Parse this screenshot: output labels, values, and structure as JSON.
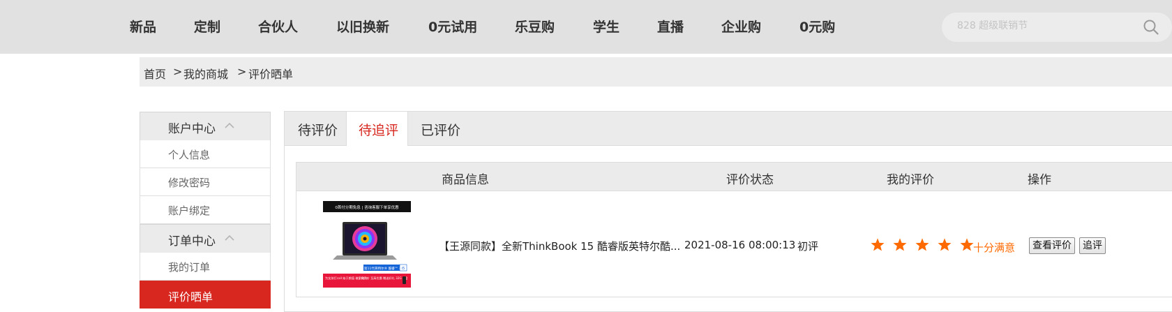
{
  "nav": {
    "items": [
      "新品",
      "定制",
      "合伙人",
      "以旧换新",
      "0元试用",
      "乐豆购",
      "学生",
      "直播",
      "企业购",
      "0元购"
    ],
    "search_placeholder": "828 超级联销节"
  },
  "breadcrumb": {
    "home": "首页",
    "sep1": ">",
    "mall": "我的商城",
    "sep2": ">",
    "current": "评价晒单"
  },
  "sidebar": {
    "account_section": {
      "label": "账户中心"
    },
    "account_items": [
      "个人信息",
      "修改密码",
      "账户绑定"
    ],
    "order_section": {
      "label": "订单中心"
    },
    "order_items": [
      "我的订单",
      "评价晒单"
    ],
    "active_item": "评价晒单"
  },
  "tabs": {
    "items": [
      "待评价",
      "待追评",
      "已评价"
    ],
    "active": "待追评"
  },
  "table": {
    "headers": [
      "商品信息",
      "评价状态",
      "我的评价",
      "操作"
    ],
    "rows": [
      {
        "product_name": "【王源同款】全新ThinkBook 15 酷睿版英特尔酷...",
        "review_date": "2021-08-16 08:00:13",
        "review_status": "初评",
        "stars": 5,
        "rating_text": "十分满意",
        "view_button": "查看评价",
        "followup_button": "追评",
        "thumbnail": {
          "banner_top": "0首付分期免息 | 咨询客服下单享优惠",
          "badge": "第11代英特尔® 酷睿™ i5",
          "promo_left": "为女孩打call\n始于颜值 敢于实力",
          "promo_mid": "全网同价 至高优惠",
          "promo_right": "赠送好礼 32G U盘"
        }
      }
    ]
  },
  "colors": {
    "accent_red": "#d7271e",
    "star_orange": "#ff6a00",
    "nav_bg": "#e1e1e1"
  }
}
